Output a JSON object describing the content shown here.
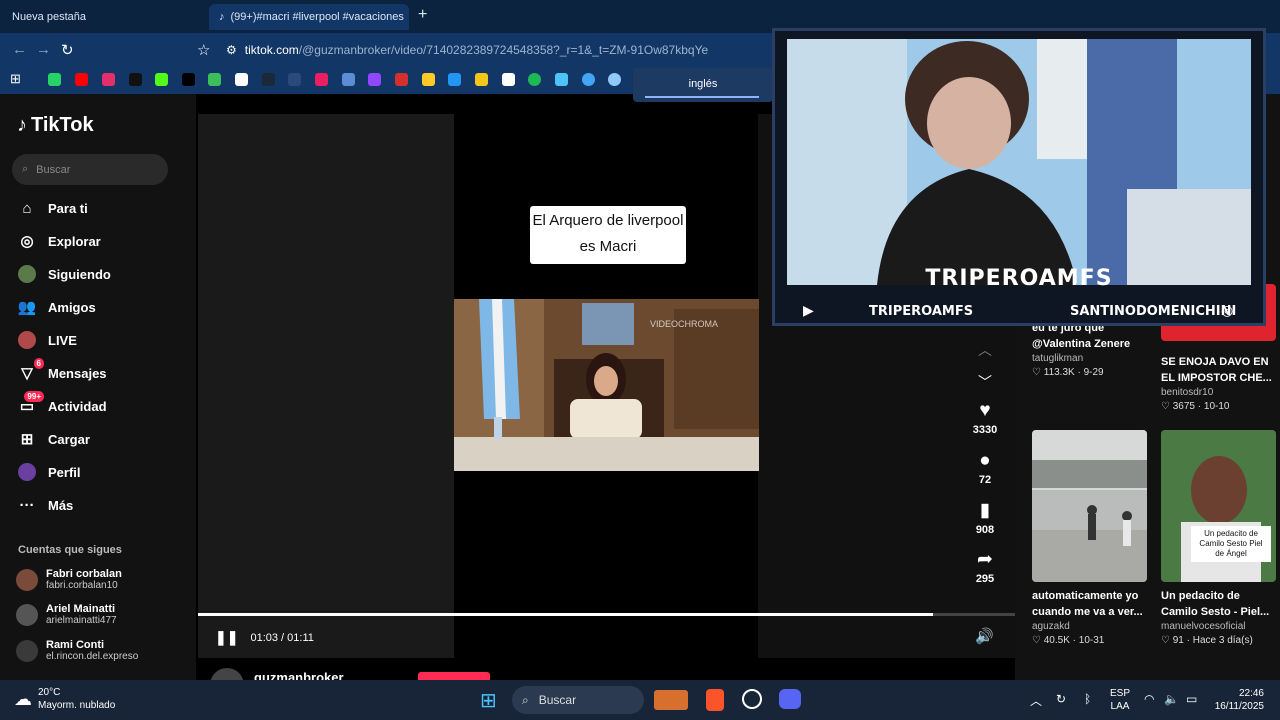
{
  "browser": {
    "tabs": [
      {
        "title": "Nueva pestaña"
      },
      {
        "title": "(99+)#macri #liverpool #vacaciones"
      }
    ],
    "url_main": "tiktok.com",
    "url_rest": "/@guzmanbroker/video/7140282389724548358?_r=1&_t=ZM-91Ow87kbqYe",
    "translate_label": "inglés"
  },
  "sidebar": {
    "brand": "TikTok",
    "search_placeholder": "Buscar",
    "menu": [
      {
        "label": "Para ti",
        "icon": "home-icon"
      },
      {
        "label": "Explorar",
        "icon": "compass-icon"
      },
      {
        "label": "Siguiendo",
        "icon": "following-icon"
      },
      {
        "label": "Amigos",
        "icon": "friends-icon"
      },
      {
        "label": "LIVE",
        "icon": "live-icon"
      },
      {
        "label": "Mensajes",
        "icon": "messages-icon",
        "badge": "6"
      },
      {
        "label": "Actividad",
        "icon": "activity-icon",
        "badge": "99+"
      },
      {
        "label": "Cargar",
        "icon": "upload-icon"
      },
      {
        "label": "Perfil",
        "icon": "profile-icon"
      },
      {
        "label": "Más",
        "icon": "more-icon"
      }
    ],
    "following_title": "Cuentas que sigues",
    "accounts": [
      {
        "name": "Fabri corbalan",
        "handle": "fabri.corbalan10"
      },
      {
        "name": "Ariel Mainatti",
        "handle": "arielmainatti477"
      },
      {
        "name": "Rami Conti",
        "handle": "el.rincon.del.expreso"
      }
    ]
  },
  "video": {
    "caption": "El Arquero de liverpool es Macri",
    "watermark": "VIDEOCHROMA",
    "time": "01:03 / 01:11",
    "progress": 0.9,
    "author": "guzmanbroker",
    "likes": "3330",
    "comments": "72",
    "saves": "908",
    "shares": "295"
  },
  "recommended": [
    {
      "title": "eu te juro que @Valentina Zenere",
      "user": "tatuglikman",
      "meta": "♡ 113.3K · 9-29"
    },
    {
      "title": "SE ENOJA DAVO EN EL IMPOSTOR CHE...",
      "user": "benitosdr10",
      "meta": "♡ 3675 · 10-10"
    },
    {
      "title": "automaticamente yo cuando me va a ver...",
      "user": "aguzakd",
      "meta": "♡ 40.5K · 10-31"
    },
    {
      "title": "Un pedacito de Camilo Sesto - Piel...",
      "user": "manuelvocesoficial",
      "meta": "♡ 91 · Hace 3 día(s)",
      "overlay": "Un pedacito de Camilo Sesto Piel de Ángel"
    }
  ],
  "webcam": {
    "name": "TRIPEROAMFS",
    "left_handle": "TRIPEROAMFS",
    "right_handle": "SANTINODOMENICHINI"
  },
  "taskbar": {
    "temp": "20°C",
    "weather": "Mayorm. nublado",
    "search": "Buscar",
    "lang1": "ESP",
    "lang2": "LAA",
    "time": "22:46",
    "date": "16/11/2025"
  },
  "colors": {
    "accent": "#fe2c55",
    "browser": "#123766",
    "taskbar": "#182538"
  }
}
